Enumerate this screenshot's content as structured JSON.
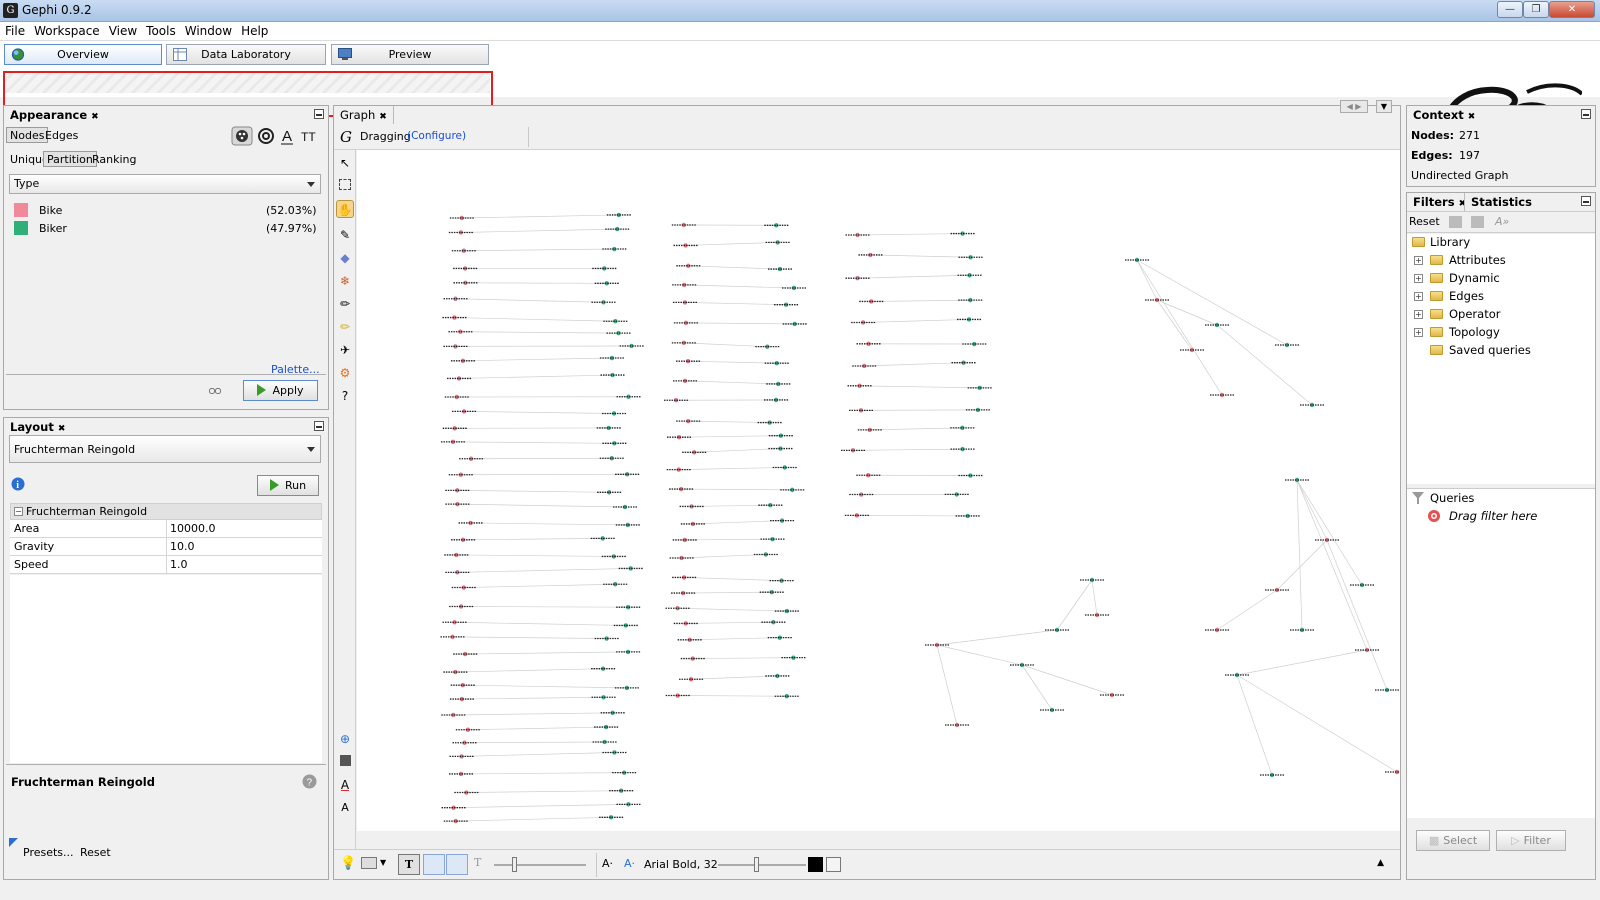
{
  "window": {
    "title": "Gephi 0.9.2"
  },
  "menu": [
    "File",
    "Workspace",
    "View",
    "Tools",
    "Window",
    "Help"
  ],
  "workspace_tabs": {
    "overview": "Overview",
    "data_laboratory": "Data Laboratory",
    "preview": "Preview"
  },
  "appearance": {
    "title": "Appearance",
    "element_toggles": [
      "Nodes",
      "Edges"
    ],
    "mode_toggles": [
      "Unique",
      "Partition",
      "Ranking"
    ],
    "attribute": "Type",
    "partitions": [
      {
        "label": "Bike",
        "percent": "(52.03%)",
        "color": "#f08a9a"
      },
      {
        "label": "Biker",
        "percent": "(47.97%)",
        "color": "#2fb07a"
      }
    ],
    "palette_link": "Palette...",
    "apply_label": "Apply"
  },
  "layout": {
    "title": "Layout",
    "algorithm": "Fruchterman Reingold",
    "run_label": "Run",
    "section": "Fruchterman Reingold",
    "properties": [
      {
        "name": "Area",
        "value": "10000.0"
      },
      {
        "name": "Gravity",
        "value": "10.0"
      },
      {
        "name": "Speed",
        "value": "1.0"
      }
    ],
    "description_title": "Fruchterman Reingold",
    "presets_label": "Presets...",
    "reset_label": "Reset"
  },
  "graph": {
    "tab": "Graph",
    "mode": "Dragging",
    "configure": "(Configure)",
    "font_label": "Arial Bold, 32"
  },
  "context": {
    "title": "Context",
    "nodes_label": "Nodes:",
    "nodes_value": "271",
    "edges_label": "Edges:",
    "edges_value": "197",
    "graph_type": "Undirected Graph"
  },
  "filters": {
    "tab_filters": "Filters",
    "tab_statistics": "Statistics",
    "reset_label": "Reset",
    "library_label": "Library",
    "library_items": [
      "Attributes",
      "Dynamic",
      "Edges",
      "Operator",
      "Topology"
    ],
    "saved_queries": "Saved queries",
    "queries_label": "Queries",
    "drag_hint": "Drag filter here",
    "select_label": "Select",
    "filter_label": "Filter"
  },
  "colors": {
    "node_pink": "#e07080",
    "node_green": "#3aa87a"
  }
}
